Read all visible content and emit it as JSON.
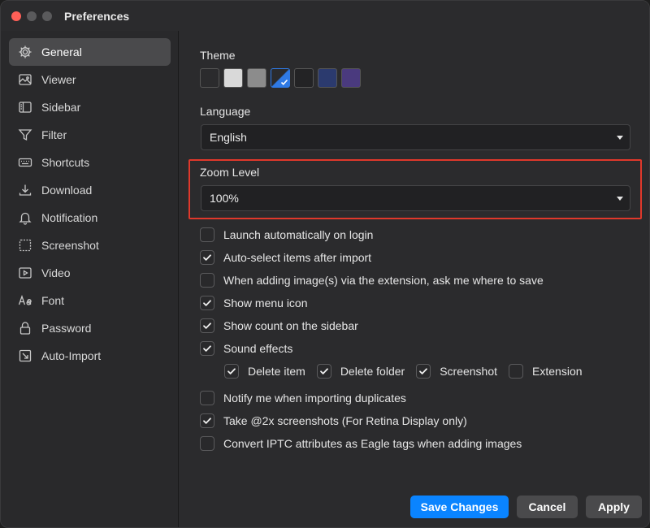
{
  "window": {
    "title": "Preferences"
  },
  "sidebar": {
    "items": [
      {
        "label": "General",
        "icon": "gear-icon",
        "active": true
      },
      {
        "label": "Viewer",
        "icon": "image-icon"
      },
      {
        "label": "Sidebar",
        "icon": "sidebar-icon"
      },
      {
        "label": "Filter",
        "icon": "filter-icon"
      },
      {
        "label": "Shortcuts",
        "icon": "keyboard-icon"
      },
      {
        "label": "Download",
        "icon": "download-icon"
      },
      {
        "label": "Notification",
        "icon": "bell-icon"
      },
      {
        "label": "Screenshot",
        "icon": "screenshot-icon"
      },
      {
        "label": "Video",
        "icon": "video-icon"
      },
      {
        "label": "Font",
        "icon": "font-icon"
      },
      {
        "label": "Password",
        "icon": "lock-icon"
      },
      {
        "label": "Auto-Import",
        "icon": "import-icon"
      }
    ]
  },
  "general": {
    "theme_label": "Theme",
    "themes": [
      {
        "color": "#2b2b2d"
      },
      {
        "color": "#d9d9d9"
      },
      {
        "color": "#8c8c8c"
      },
      {
        "color": "#3b4a6b",
        "selected": true
      },
      {
        "color": "#232325"
      },
      {
        "color": "#2b3a6e"
      },
      {
        "color": "#4a3a7e"
      }
    ],
    "language_label": "Language",
    "language_value": "English",
    "zoom_label": "Zoom Level",
    "zoom_value": "100%"
  },
  "options": [
    {
      "label": "Launch automatically on login",
      "checked": false
    },
    {
      "label": "Auto-select items after import",
      "checked": true
    },
    {
      "label": "When adding image(s) via the extension, ask me where to save",
      "checked": false
    },
    {
      "label": "Show menu icon",
      "checked": true
    },
    {
      "label": "Show count on the sidebar",
      "checked": true
    },
    {
      "label": "Sound effects",
      "checked": true
    }
  ],
  "sound_effects": [
    {
      "label": "Delete item",
      "checked": true
    },
    {
      "label": "Delete folder",
      "checked": true
    },
    {
      "label": "Screenshot",
      "checked": true
    },
    {
      "label": "Extension",
      "checked": false
    }
  ],
  "options2": [
    {
      "label": "Notify me when importing duplicates",
      "checked": false
    },
    {
      "label": "Take @2x screenshots (For Retina Display only)",
      "checked": true
    },
    {
      "label": "Convert IPTC attributes as Eagle tags when adding images",
      "checked": false
    }
  ],
  "buttons": {
    "save": "Save Changes",
    "cancel": "Cancel",
    "apply": "Apply"
  },
  "colors": {
    "accent": "#0a84ff",
    "highlight": "#e0382b"
  }
}
